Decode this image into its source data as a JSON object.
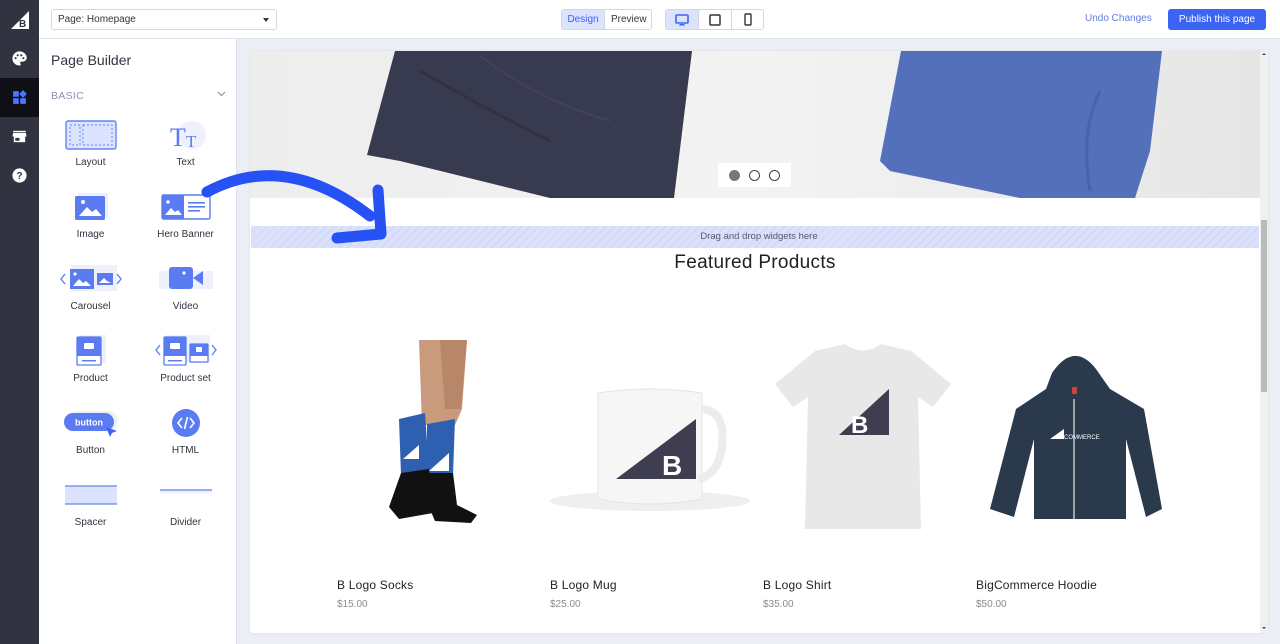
{
  "app": {
    "brand": "BigCommerce",
    "accent": "#3c64f4"
  },
  "rail": {
    "items": [
      {
        "icon": "bigcommerce-logo-icon"
      },
      {
        "icon": "palette-icon",
        "label": "Theme styles"
      },
      {
        "icon": "widgets-icon",
        "label": "Page Builder",
        "active": true
      },
      {
        "icon": "storefront-icon",
        "label": "Store"
      },
      {
        "icon": "help-icon",
        "label": "Help"
      }
    ]
  },
  "topbar": {
    "page_select": "Page: Homepage",
    "mode_tabs": [
      {
        "label": "Design",
        "active": true
      },
      {
        "label": "Preview",
        "active": false
      }
    ],
    "device_tabs": [
      {
        "icon": "desktop-icon",
        "active": true
      },
      {
        "icon": "tablet-icon",
        "active": false
      },
      {
        "icon": "mobile-icon",
        "active": false
      }
    ],
    "undo_label": "Undo Changes",
    "publish_label": "Publish this page"
  },
  "panel": {
    "title": "Page Builder",
    "section": "BASIC",
    "widgets": [
      {
        "label": "Layout",
        "icon": "layout-icon"
      },
      {
        "label": "Text",
        "icon": "text-icon"
      },
      {
        "label": "Image",
        "icon": "image-icon"
      },
      {
        "label": "Hero Banner",
        "icon": "hero-banner-icon"
      },
      {
        "label": "Carousel",
        "icon": "carousel-icon"
      },
      {
        "label": "Video",
        "icon": "video-icon"
      },
      {
        "label": "Product",
        "icon": "product-icon"
      },
      {
        "label": "Product set",
        "icon": "product-set-icon"
      },
      {
        "label": "Button",
        "icon": "button-icon",
        "icon_text": "button"
      },
      {
        "label": "HTML",
        "icon": "html-icon"
      },
      {
        "label": "Spacer",
        "icon": "spacer-icon"
      },
      {
        "label": "Divider",
        "icon": "divider-icon"
      }
    ]
  },
  "canvas": {
    "carousel": {
      "slides": 3,
      "active_slide": 1
    },
    "dropzone_text": "Drag and drop widgets here",
    "featured_title": "Featured Products",
    "products": [
      {
        "name": "B Logo Socks",
        "price": "$15.00",
        "image": "socks"
      },
      {
        "name": "B Logo Mug",
        "price": "$25.00",
        "image": "mug"
      },
      {
        "name": "B Logo Shirt",
        "price": "$35.00",
        "image": "shirt"
      },
      {
        "name": "BigCommerce Hoodie",
        "price": "$50.00",
        "image": "hoodie",
        "print_text": "COMMERCE"
      }
    ]
  }
}
